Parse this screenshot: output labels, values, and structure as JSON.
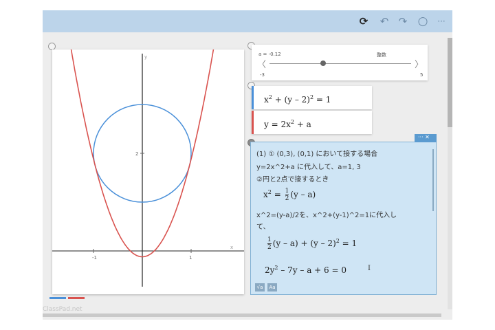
{
  "toolbar": {
    "icons": [
      "sync-icon",
      "undo-icon",
      "redo-icon",
      "circle-icon",
      "more-icon"
    ],
    "sync": "⟳",
    "undo": "↶",
    "redo": "↷",
    "circle": "○",
    "more": "···"
  },
  "slider": {
    "label": "a = -0.12",
    "mode": "整数",
    "min": "-3",
    "max": "5",
    "left_arrow": "〈",
    "right_arrow": "〉",
    "value": -0.12
  },
  "equations": [
    {
      "id": "circle",
      "color": "#4a90d9"
    },
    {
      "id": "parabola",
      "color": "#d9534f"
    }
  ],
  "graph": {
    "x_ticks": [
      "-1",
      "1"
    ],
    "y_ticks": [
      "2"
    ],
    "x_axis": "x",
    "y_axis": "y"
  },
  "note": {
    "line1": "(1) ① (0,3), (0,1) において接する場合",
    "line2": "y=2x^2+a に代入して、a=1, 3",
    "line3": "②円と2点で接するとき",
    "line5": "x^2=(y-a)/2を、x^2+(y-1)^2=1に代入し",
    "line6": "て、",
    "cursor": "I",
    "button_sqrt": "√a",
    "button_text": "Aa",
    "head": "··· ✕"
  },
  "watermark": "ClassPad.net"
}
